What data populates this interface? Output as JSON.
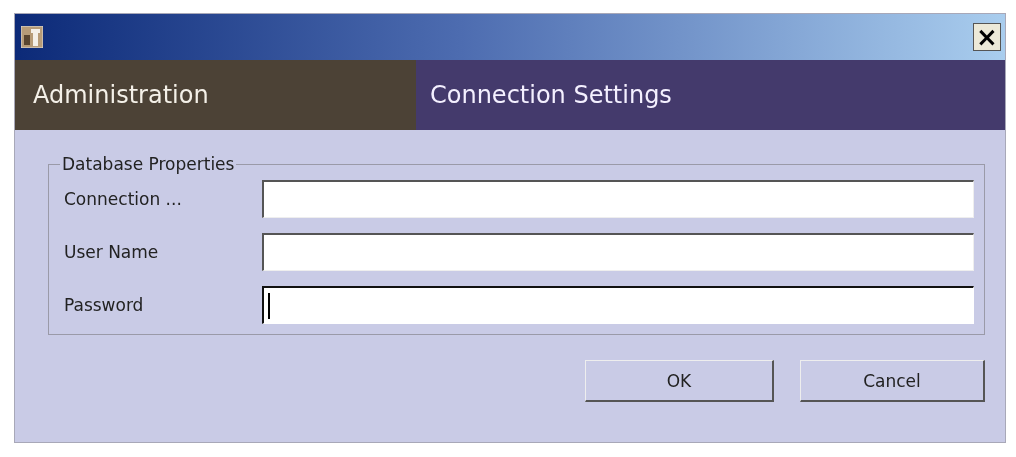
{
  "window": {
    "close_label": "×"
  },
  "header": {
    "section": "Administration",
    "page": "Connection Settings"
  },
  "group": {
    "title": "Database Properties",
    "fields": [
      {
        "label": "Connection ...",
        "focused": false
      },
      {
        "label": "User Name",
        "focused": false
      },
      {
        "label": "Password",
        "focused": true
      }
    ]
  },
  "buttons": [
    "OK",
    "Cancel"
  ]
}
